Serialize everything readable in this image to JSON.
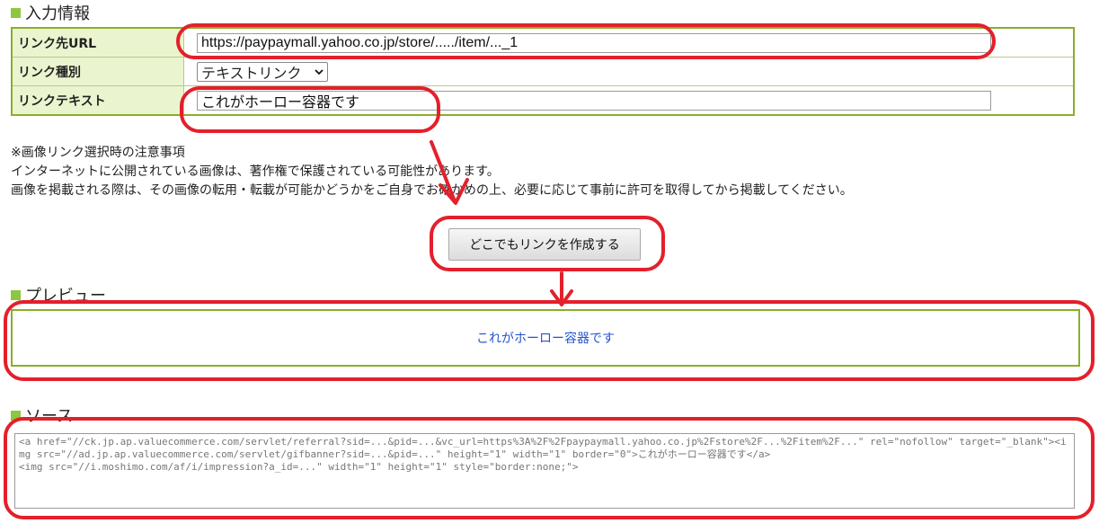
{
  "input_section": {
    "title": "入力情報"
  },
  "form": {
    "link_url_label": "リンク先URL",
    "link_url_value": "https://paypaymall.yahoo.co.jp/store/...../item/..._1",
    "link_type_label": "リンク種別",
    "link_type_value": "テキストリンク",
    "link_text_label": "リンクテキスト",
    "link_text_value": "これがホーロー容器です"
  },
  "notes": {
    "line1": "※画像リンク選択時の注意事項",
    "line2": "インターネットに公開されている画像は、著作権で保護されている可能性があります。",
    "line3": "画像を掲載される際は、その画像の転用・転載が可能かどうかをご自身でお確かめの上、必要に応じて事前に許可を取得してから掲載してください。"
  },
  "create_button_label": "どこでもリンクを作成する",
  "preview_section": {
    "title": "プレビュー",
    "link_text": "これがホーロー容器です"
  },
  "source_section": {
    "title": "ソース",
    "code": "<a href=\"//ck.jp.ap.valuecommerce.com/servlet/referral?sid=...&pid=...&vc_url=https%3A%2F%2Fpaypaymall.yahoo.co.jp%2Fstore%2F...%2Fitem%2F...\" rel=\"nofollow\" target=\"_blank\"><img src=\"//ad.jp.ap.valuecommerce.com/servlet/gifbanner?sid=...&pid=...\" height=\"1\" width=\"1\" border=\"0\">これがホーロー容器です</a>\n<img src=\"//i.moshimo.com/af/i/impression?a_id=...\" width=\"1\" height=\"1\" style=\"border:none;\">"
  },
  "colors": {
    "accent_green": "#8dc63f",
    "annotation_red": "#e3202b",
    "link_blue": "#2255cc"
  }
}
